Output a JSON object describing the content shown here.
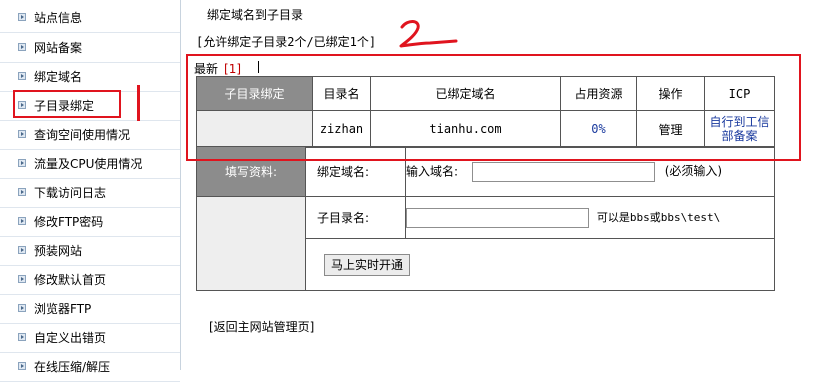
{
  "sidebar": {
    "items": [
      {
        "label": "站点信息"
      },
      {
        "label": "网站备案"
      },
      {
        "label": "绑定域名"
      },
      {
        "label": "子目录绑定"
      },
      {
        "label": "查询空间使用情况"
      },
      {
        "label": "流量及CPU使用情况"
      },
      {
        "label": "下载访问日志"
      },
      {
        "label": "修改FTP密码"
      },
      {
        "label": "预装网站"
      },
      {
        "label": "修改默认首页"
      },
      {
        "label": "浏览器FTP"
      },
      {
        "label": "自定义出错页"
      },
      {
        "label": "在线压缩/解压"
      }
    ]
  },
  "main": {
    "title": "绑定域名到子目录",
    "allow_text": "[允许绑定子目录2个/已绑定1个]",
    "latest_label": "最新",
    "latest_page": "[1]",
    "binding_table": {
      "row_header": "子目录绑定",
      "columns": [
        "目录名",
        "已绑定域名",
        "占用资源",
        "操作",
        "ICP"
      ],
      "rows": [
        {
          "dir": "zizhan",
          "domain": "tianhu.com",
          "usage": "0%",
          "action": "管理",
          "icp_line1": "自行到工信",
          "icp_line2": "部备案"
        }
      ]
    },
    "form": {
      "header": "填写资料:",
      "domain_label": "绑定域名:",
      "domain_input_label": "输入域名:",
      "domain_input_value": "",
      "domain_hint": "(必须输入)",
      "subdir_label": "子目录名:",
      "subdir_input_value": "",
      "subdir_hint": "可以是bbs或bbs\\test\\",
      "submit_label": "马上实时开通"
    },
    "back_link": "[返回主网站管理页]"
  },
  "colors": {
    "annotation_red": "#e0141e",
    "header_gray": "#8c8c8c",
    "link_blue": "#1a3a9e"
  }
}
